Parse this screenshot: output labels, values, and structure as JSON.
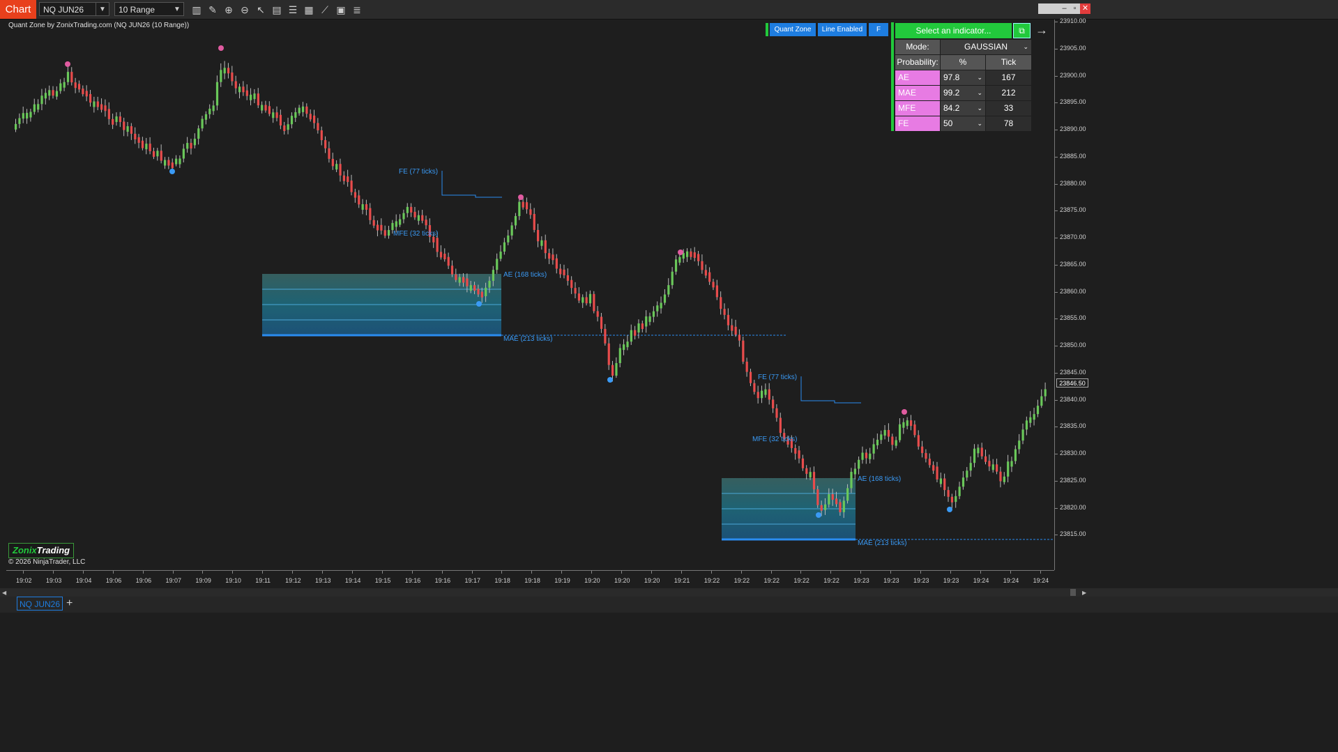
{
  "toolbar": {
    "chart_tab": "Chart",
    "instrument": "NQ JUN26",
    "interval": "10 Range",
    "tools": [
      "bar-chart-icon",
      "pencil-icon",
      "zoom-in-icon",
      "zoom-out-icon",
      "pointer-icon",
      "properties-icon",
      "data-box-icon",
      "indicators-icon",
      "strategies-icon",
      "calculator-icon",
      "list-icon"
    ]
  },
  "chart": {
    "indicator_title": "Quant Zone by ZonixTrading.com (NQ JUN26 (10 Range))",
    "header_buttons": [
      "Quant Zone",
      "Line Enabled",
      "F"
    ],
    "brand_name_part1": "Zonix",
    "brand_name_part2": "Trading",
    "copyright": "© 2026 NinjaTrader, LLC",
    "current_price": "23846.50",
    "price_ticks": [
      "23910.00",
      "23905.00",
      "23900.00",
      "23895.00",
      "23890.00",
      "23885.00",
      "23880.00",
      "23875.00",
      "23870.00",
      "23865.00",
      "23860.00",
      "23855.00",
      "23850.00",
      "23845.00",
      "23840.00",
      "23835.00",
      "23830.00",
      "23825.00",
      "23820.00",
      "23815.00"
    ],
    "time_ticks": [
      "19:02",
      "19:03",
      "19:04",
      "19:06",
      "19:06",
      "19:07",
      "19:09",
      "19:10",
      "19:11",
      "19:12",
      "19:13",
      "19:14",
      "19:15",
      "19:16",
      "19:16",
      "19:17",
      "19:18",
      "19:18",
      "19:19",
      "19:20",
      "19:20",
      "19:20",
      "19:21",
      "19:22",
      "19:22",
      "19:22",
      "19:22",
      "19:22",
      "19:23",
      "19:23",
      "19:23",
      "19:23",
      "19:24",
      "19:24",
      "19:24"
    ],
    "zone1": {
      "fe": "FE (77 ticks)",
      "mfe": "MFE (32 ticks)",
      "ae": "AE (168 ticks)",
      "mae": "MAE (213 ticks)"
    },
    "zone2": {
      "fe": "FE (77 ticks)",
      "mfe": "MFE (32 ticks)",
      "ae": "AE (168 ticks)",
      "mae": "MAE (213 ticks)"
    }
  },
  "panel": {
    "select_label": "Select an indicator...",
    "mode_label": "Mode:",
    "mode_value": "GAUSSIAN",
    "probability_label": "Probability:",
    "col_pct": "%",
    "col_tick": "Tick",
    "rows": [
      {
        "name": "AE",
        "pct": "97.8",
        "tick": "167"
      },
      {
        "name": "MAE",
        "pct": "99.2",
        "tick": "212"
      },
      {
        "name": "MFE",
        "pct": "84.2",
        "tick": "33"
      },
      {
        "name": "FE",
        "pct": "50",
        "tick": "78"
      }
    ]
  },
  "bottom": {
    "tab": "NQ JUN26",
    "add": "+"
  },
  "colors": {
    "up": "#6ac85a",
    "down": "#e84c4c",
    "accent": "#1e7de0",
    "panel_green": "#22c93c",
    "row_pink": "#e77be3"
  }
}
